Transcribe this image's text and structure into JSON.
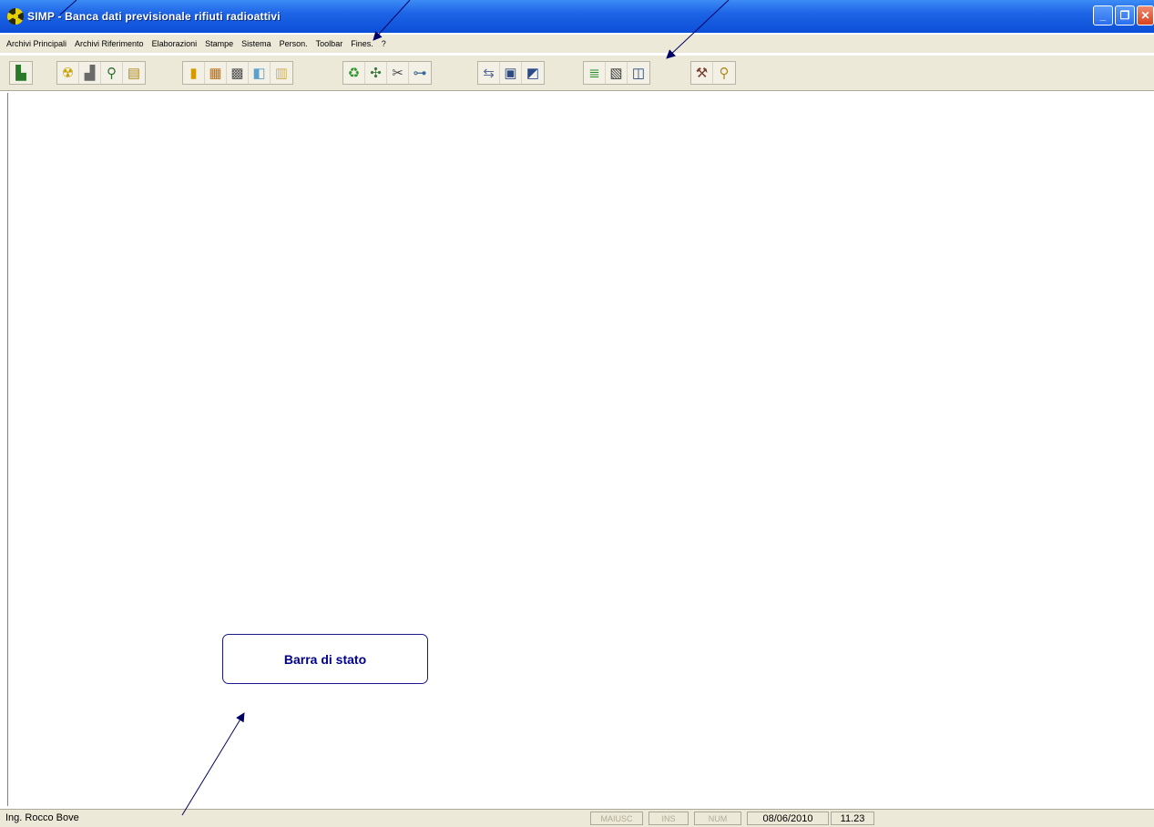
{
  "window": {
    "title": "SIMP - Banca dati previsionale rifiuti radioattivi",
    "controls": {
      "minimize": "_",
      "maximize": "❐",
      "close": "✕"
    }
  },
  "menubar": {
    "items": [
      "Archivi Principali",
      "Archivi Riferimento",
      "Elaborazioni",
      "Stampe",
      "Sistema",
      "Person.",
      "Toolbar",
      "Fines.",
      "?"
    ]
  },
  "toolbar": {
    "groups": [
      {
        "icons": [
          "exit-door-icon"
        ]
      },
      {
        "icons": [
          "radiation-icon",
          "factory-icon",
          "tree-structure-icon",
          "document-icon"
        ]
      },
      {
        "icons": [
          "barrel-icon",
          "container-icon",
          "storage-icon",
          "cylinder-icon",
          "box-icon"
        ]
      },
      {
        "icons": [
          "recycle-icon",
          "network-icon",
          "scissors-icon",
          "hierarchy-icon"
        ]
      },
      {
        "icons": [
          "transfer-icon",
          "disk-icon",
          "disk-save-icon"
        ]
      },
      {
        "icons": [
          "traffic-light-icon",
          "chart-icon",
          "database-icon"
        ]
      },
      {
        "icons": [
          "tools-icon",
          "wrench-icon"
        ]
      }
    ]
  },
  "statusbar": {
    "user": "Ing. Rocco Bove",
    "caps": "MAIUSC",
    "ins": "INS",
    "num": "NUM",
    "date": "08/06/2010",
    "time": "11.23"
  },
  "annotation": {
    "label": "Barra di stato",
    "color": "#00008b"
  }
}
